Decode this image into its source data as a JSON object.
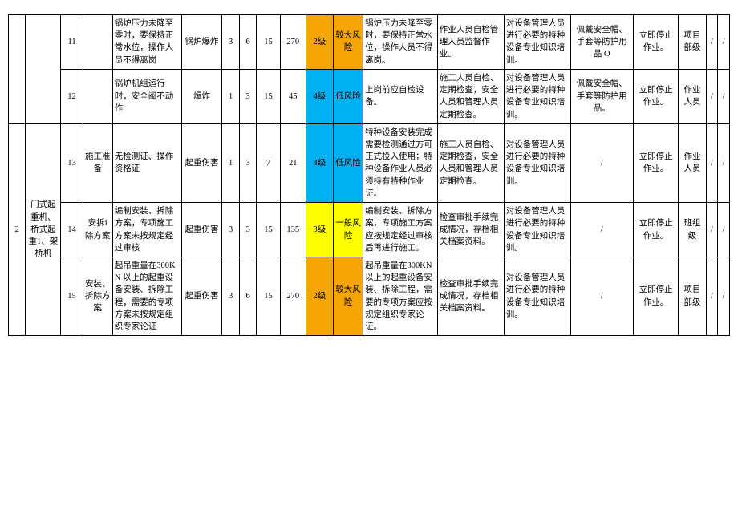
{
  "group_seq": "2",
  "group_category": "门式起重机、桥式起重1、架桥机",
  "colors": {
    "orange": "#F5A506",
    "blue": "#00B0F0",
    "yellow": "#FFFF00"
  },
  "rows": [
    {
      "seq": "11",
      "stage": "",
      "hazard": "锅炉压力未降至零时，要保持正常水位，操作人员不得离岗",
      "accident": "锅炉爆炸",
      "l": "3",
      "e": "6",
      "c": "15",
      "d": "270",
      "level": "2级",
      "level_color": "orange",
      "risk": "较大风险",
      "risk_color": "orange",
      "measure": "锅炉压力未降至零时，要保持正常水位，操作人员不得离岗。",
      "mgmt": "作业人员自检管理人员监督作业。",
      "training": "对设备管理人员进行必要的特种设备专业知识培训。",
      "ppe": "佩戴安全帽、手套等防护用品 O",
      "emergency": "立即停止作业。",
      "resp": "项目部级",
      "extra1": "/",
      "extra2": "/"
    },
    {
      "seq": "12",
      "stage": "",
      "hazard": "锅炉机组运行时，安全阀不动作",
      "accident": "爆炸",
      "l": "1",
      "e": "3",
      "c": "15",
      "d": "45",
      "level": "4级",
      "level_color": "blue",
      "risk": "低风险",
      "risk_color": "blue",
      "measure": "上岗前应自检设备。",
      "mgmt": "施工人员自检、定期检查，安全人员和管理人员定期检查。",
      "training": "对设备管理人员进行必要的特种设备专业知识培训。",
      "ppe": "佩戴安全帽、手套等防护用品。",
      "emergency": "立即停止作业。",
      "resp": "作业人员",
      "extra1": "/",
      "extra2": "/"
    },
    {
      "seq": "13",
      "stage": "施工准备",
      "hazard": "无检测证、操作资格证",
      "accident": "起重伤害",
      "l": "1",
      "e": "3",
      "c": "7",
      "d": "21",
      "level": "4级",
      "level_color": "blue",
      "risk": "低风险",
      "risk_color": "blue",
      "measure": "特种设备安装完成需要检测通过方可正式投入使用；特种设备作业人员必须持有特种作业证。",
      "mgmt": "施工人员自检、定期检查，安全人员和管理人员定期检查。",
      "training": "对设备管理人员进行必要的特种设备专业知识培训。",
      "ppe": "/",
      "emergency": "立即停止作业。",
      "resp": "作业人员",
      "extra1": "/",
      "extra2": "/"
    },
    {
      "seq": "14",
      "stage": "安拆i除方案",
      "hazard": "编制安装、拆除方案，专项施工方案未按规定经过审核",
      "accident": "起重伤害",
      "l": "3",
      "e": "3",
      "c": "15",
      "d": "135",
      "level": "3级",
      "level_color": "yellow",
      "risk": "一般风险",
      "risk_color": "yellow",
      "measure": "编制安装、拆除方案，专项施工方案应按规定经过审核后再进行施工。",
      "mgmt": "检查审批手续完成情况，存档相关档案资料。",
      "training": "对设备管理人员进行必要的特种设备专业知识培训。",
      "ppe": "/",
      "emergency": "立即停止作业。",
      "resp": "班组级",
      "extra1": "/",
      "extra2": "/"
    },
    {
      "seq": "15",
      "stage": "安装、拆除方案",
      "hazard": "起吊重量在300KN 以上的起重设备安装、拆除工程，需要的专项方案未按规定组织专家论证",
      "accident": "起重伤害",
      "l": "3",
      "e": "6",
      "c": "15",
      "d": "270",
      "level": "2级",
      "level_color": "orange",
      "risk": "较大风险",
      "risk_color": "orange",
      "measure": "起吊重量在300KN 以上的起重设备安装、拆除工程，需要的专项方案应按规定组织专家论证。",
      "mgmt": "检查审批手续完成情况，存档相关档案资料。",
      "training": "对设备管理人员进行必要的特种设备专业知识培训。",
      "ppe": "/",
      "emergency": "立即停止作业。",
      "resp": "项目部级",
      "extra1": "/",
      "extra2": "/"
    }
  ]
}
